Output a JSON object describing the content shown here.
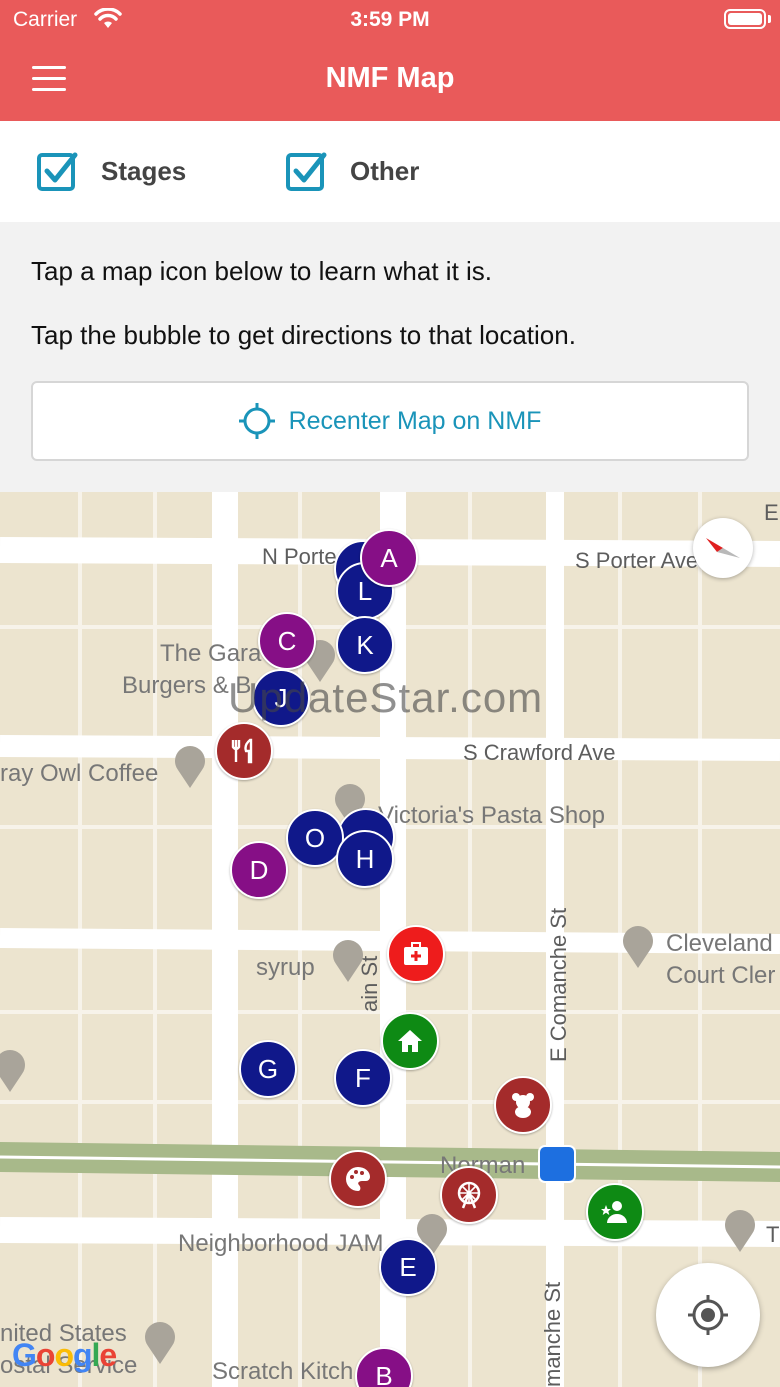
{
  "status_bar": {
    "carrier": "Carrier",
    "time": "3:59 PM"
  },
  "header": {
    "title": "NMF Map"
  },
  "filters": [
    {
      "label": "Stages",
      "checked": true
    },
    {
      "label": "Other",
      "checked": true
    }
  ],
  "info": {
    "line1": "Tap a map icon below to learn what it is.",
    "line2": "Tap the bubble to get directions to that location.",
    "recenter_label": "Recenter Map on NMF"
  },
  "map": {
    "streets": {
      "n_porter": "N Porte",
      "s_porter": "S Porter Ave",
      "s_crawford": "S Crawford Ave",
      "main_st": "ain St",
      "e_comanche": "E Comanche St",
      "manche_st": "manche St",
      "norman": "Norman",
      "e_edge": "E",
      "t_edge": "T"
    },
    "places": {
      "garage_1": "The Gara",
      "garage_2": "Burgers & B",
      "gray_owl": "ray Owl Coffee",
      "victorias": "Victoria's Pasta Shop",
      "syrup": "syrup",
      "cleveland_1": "Cleveland",
      "cleveland_2": "Court Cler",
      "neighborhood_jam": "Neighborhood JAM",
      "united_states_1": "nited States",
      "united_states_2": "ostal Service",
      "scratch": "Scratch Kitch"
    },
    "watermark": "UpdateStar.com",
    "google_logo": "Google",
    "markers": [
      {
        "letter": "A",
        "color": "purple"
      },
      {
        "letter": "L",
        "color": "navy"
      },
      {
        "letter": "C",
        "color": "purple"
      },
      {
        "letter": "K",
        "color": "navy"
      },
      {
        "letter": "J",
        "color": "navy"
      },
      {
        "letter": "O",
        "color": "navy"
      },
      {
        "letter": "H",
        "color": "navy"
      },
      {
        "letter": "D",
        "color": "purple"
      },
      {
        "letter": "G",
        "color": "navy"
      },
      {
        "letter": "F",
        "color": "navy"
      },
      {
        "letter": "E",
        "color": "navy"
      },
      {
        "letter": "B",
        "color": "purple"
      }
    ],
    "icon_markers": [
      {
        "icon": "restaurant-icon",
        "color": "brick"
      },
      {
        "icon": "first-aid-icon",
        "color": "red"
      },
      {
        "icon": "home-icon",
        "color": "green"
      },
      {
        "icon": "teddy-bear-icon",
        "color": "brick"
      },
      {
        "icon": "palette-icon",
        "color": "brick"
      },
      {
        "icon": "ferris-wheel-icon",
        "color": "brick"
      },
      {
        "icon": "user-star-icon",
        "color": "green"
      }
    ]
  },
  "colors": {
    "header": "#e95a5a",
    "accent": "#1a94b9",
    "navy": "#10188a",
    "purple": "#860f86",
    "brick": "#a42b2b",
    "green": "#0e8a14",
    "map_bg": "#ece4cf"
  }
}
